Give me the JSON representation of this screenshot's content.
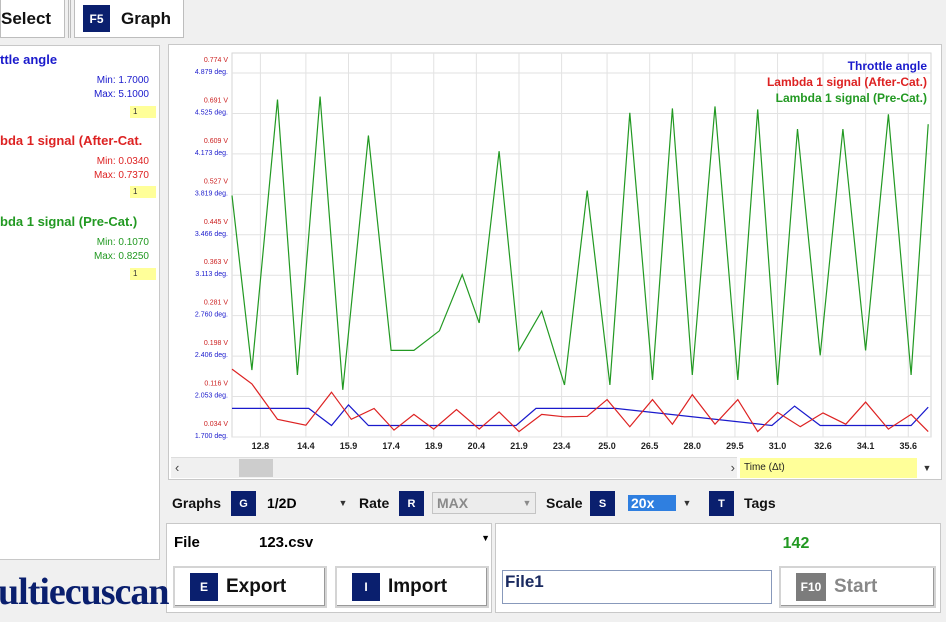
{
  "tabs": {
    "select_label": "Select",
    "graph_key": "F5",
    "graph_label": "Graph"
  },
  "series": [
    {
      "name": "ttle angle",
      "min": "Min: 1.7000",
      "max": "Max: 5.1000",
      "badge": "1",
      "color": "#1a1acc"
    },
    {
      "name": "bda 1 signal (After-Cat.",
      "min": "Min: 0.0340",
      "max": "Max: 0.7370",
      "badge": "1",
      "color": "#dd2222"
    },
    {
      "name": "bda 1 signal (Pre-Cat.)",
      "min": "Min: 0.1070",
      "max": "Max: 0.8250",
      "badge": "1",
      "color": "#229922"
    }
  ],
  "chart_data": {
    "type": "line",
    "title": "",
    "legend": [
      "Throttle angle",
      "Lambda 1 signal (After-Cat.)",
      "Lambda 1 signal (Pre-Cat.)"
    ],
    "legend_colors": [
      "#1a1acc",
      "#dd2222",
      "#229922"
    ],
    "legend_placement": "top-right",
    "xlabel": "Time (Δt)",
    "x_ticks": [
      "12.8",
      "14.4",
      "15.9",
      "17.4",
      "18.9",
      "20.4",
      "21.9",
      "23.4",
      "25.0",
      "26.5",
      "28.0",
      "29.5",
      "31.0",
      "32.6",
      "34.1",
      "35.6"
    ],
    "x_tick_values": [
      12.8,
      14.4,
      15.9,
      17.4,
      18.9,
      20.4,
      21.9,
      23.4,
      25.0,
      26.5,
      28.0,
      29.5,
      31.0,
      32.6,
      34.1,
      35.6
    ],
    "xlim": [
      11.8,
      36.4
    ],
    "y_ticks_volt": [
      "0.774 V",
      "0.691 V",
      "0.609 V",
      "0.527 V",
      "0.445 V",
      "0.363 V",
      "0.281 V",
      "0.198 V",
      "0.116 V",
      "0.034 V"
    ],
    "y_ticks_deg": [
      "4.879 deg.",
      "4.525 deg.",
      "4.173 deg.",
      "3.819 deg.",
      "3.466 deg.",
      "3.113 deg.",
      "2.760 deg.",
      "2.406 deg.",
      "2.053 deg.",
      "1.700 deg."
    ],
    "ylim_volt": [
      0.034,
      0.774
    ],
    "ylim_deg": [
      1.7,
      4.879
    ],
    "grid": true,
    "series_values": [
      {
        "name": "Throttle angle",
        "axis": "deg",
        "x": [
          11.8,
          13.4,
          14.5,
          15.3,
          15.9,
          16.6,
          21.8,
          22.5,
          25.3,
          30.8,
          31.6,
          32.5,
          35.7,
          36.3
        ],
        "y": [
          1.95,
          1.95,
          1.95,
          1.8,
          1.98,
          1.8,
          1.8,
          1.95,
          1.95,
          1.8,
          1.97,
          1.8,
          1.8,
          1.96
        ]
      },
      {
        "name": "Lambda 1 signal (After-Cat.)",
        "axis": "volt",
        "x": [
          11.8,
          12.5,
          13.4,
          14.4,
          15.3,
          16.0,
          16.8,
          17.5,
          18.2,
          18.9,
          19.7,
          20.5,
          21.2,
          21.9,
          22.7,
          23.5,
          24.3,
          25.0,
          25.8,
          26.6,
          27.3,
          28.0,
          28.8,
          29.6,
          30.3,
          31.0,
          31.8,
          32.6,
          33.4,
          34.1,
          34.9,
          35.7,
          36.3
        ],
        "y": [
          0.172,
          0.142,
          0.07,
          0.058,
          0.125,
          0.07,
          0.092,
          0.048,
          0.08,
          0.05,
          0.09,
          0.05,
          0.085,
          0.045,
          0.08,
          0.075,
          0.076,
          0.11,
          0.055,
          0.11,
          0.06,
          0.12,
          0.06,
          0.11,
          0.045,
          0.084,
          0.055,
          0.083,
          0.06,
          0.105,
          0.05,
          0.08,
          0.045
        ]
      },
      {
        "name": "Lambda 1 signal (Pre-Cat.)",
        "axis": "volt",
        "x": [
          11.8,
          12.5,
          13.4,
          14.1,
          14.9,
          15.7,
          16.6,
          17.4,
          18.2,
          19.1,
          19.9,
          20.5,
          21.2,
          21.9,
          22.7,
          23.5,
          24.3,
          25.1,
          25.8,
          26.6,
          27.3,
          28.0,
          28.8,
          29.6,
          30.3,
          31.0,
          31.7,
          32.5,
          33.3,
          34.1,
          34.9,
          35.7,
          36.3
        ],
        "y": [
          0.525,
          0.17,
          0.72,
          0.16,
          0.726,
          0.13,
          0.647,
          0.21,
          0.21,
          0.25,
          0.364,
          0.266,
          0.615,
          0.21,
          0.29,
          0.14,
          0.535,
          0.14,
          0.693,
          0.15,
          0.702,
          0.16,
          0.706,
          0.15,
          0.7,
          0.14,
          0.66,
          0.2,
          0.66,
          0.21,
          0.69,
          0.16,
          0.67
        ]
      }
    ]
  },
  "controls": {
    "graphs_label": "Graphs",
    "graphs_key": "G",
    "graphs_value": "1/2D",
    "rate_label": "Rate",
    "rate_key": "R",
    "rate_value": "MAX",
    "scale_label": "Scale",
    "scale_key": "S",
    "scale_value": "20x",
    "tags_key": "T",
    "tags_label": "Tags"
  },
  "file": {
    "label": "File",
    "value": "123.csv",
    "export_key": "E",
    "export_label": "Export",
    "import_key": "I",
    "import_label": "Import"
  },
  "start": {
    "count": "142",
    "name_value": "File1",
    "start_key": "F10",
    "start_label": "Start"
  },
  "brand": {
    "logo_text": "ultiecuscan"
  }
}
